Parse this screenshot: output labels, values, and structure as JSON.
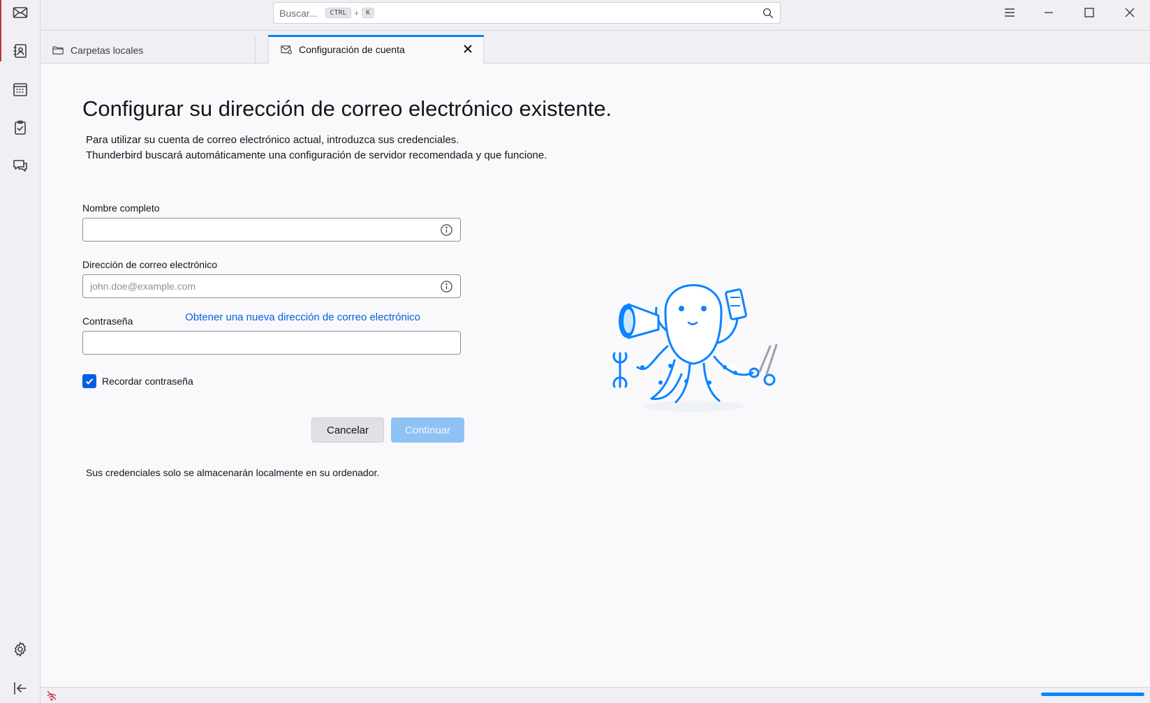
{
  "app": {
    "accent": "#0060df",
    "brand_red": "#c2343f"
  },
  "spaces": {
    "items": [
      {
        "name": "mail",
        "icon": "mail-icon"
      },
      {
        "name": "address-book",
        "icon": "address-book-icon"
      },
      {
        "name": "calendar",
        "icon": "calendar-icon"
      },
      {
        "name": "tasks",
        "icon": "tasks-icon"
      },
      {
        "name": "chat",
        "icon": "chat-icon"
      }
    ],
    "settings_icon": "gear-icon",
    "collapse_icon": "collapse-sidebar-icon"
  },
  "search": {
    "placeholder": "Buscar...",
    "shortcut_key1": "CTRL",
    "shortcut_plus": "+",
    "shortcut_key2": "K"
  },
  "tabs": [
    {
      "label": "Carpetas locales",
      "icon": "folder-icon",
      "active": false
    },
    {
      "label": "Configuración de cuenta",
      "icon": "mail-settings-icon",
      "active": true
    }
  ],
  "setup": {
    "title": "Configurar su dirección de correo electrónico existente.",
    "desc_line1": "Para utilizar su cuenta de correo electrónico actual, introduzca sus credenciales.",
    "desc_line2": "Thunderbird buscará automáticamente una configuración de servidor recomendada y que funcione.",
    "name_label": "Nombre completo",
    "name_value": "",
    "email_label": "Dirección de correo electrónico",
    "email_placeholder": "john.doe@example.com",
    "new_address_link": "Obtener una nueva dirección de correo electrónico",
    "password_label": "Contraseña",
    "password_value": "",
    "remember_label": "Recordar contraseña",
    "remember_checked": true,
    "cancel_label": "Cancelar",
    "continue_label": "Continuar",
    "note": "Sus credenciales solo se almacenarán localmente en su ordenador."
  },
  "statusbar": {
    "progress_fraction": 1.0
  }
}
